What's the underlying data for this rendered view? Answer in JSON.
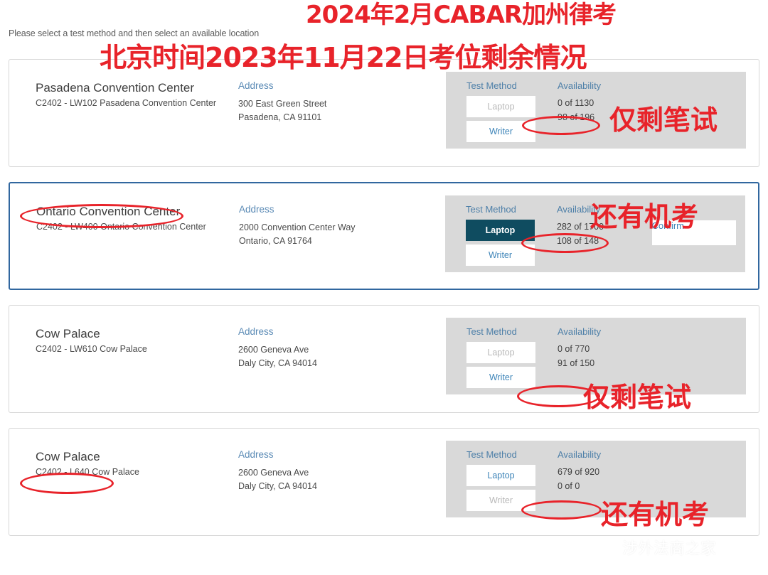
{
  "instruction": "Please select a test method and then select an available location",
  "annotations": {
    "title_line1": "2024年2月CABAR加州律考",
    "title_line2": "北京时间2023年11月22日考位剩余情况",
    "notes": [
      "仅剩笔试",
      "还有机考",
      "仅剩笔试",
      "还有机考"
    ],
    "color": "#e8232a"
  },
  "watermark": {
    "icon": "wechat-icon",
    "text": "涉外法商之家"
  },
  "columns": {
    "test_method": "Test Method",
    "availability": "Availability",
    "address": "Address"
  },
  "buttons": {
    "laptop": "Laptop",
    "writer": "Writer",
    "confirm": "Confirm"
  },
  "cards": [
    {
      "venue": "Pasadena Convention Center",
      "code": "C2402 - LW102 Pasadena Convention Center",
      "address_line1": "300 East Green Street",
      "address_line2": "Pasadena, CA 91101",
      "laptop_state": "disabled",
      "writer_state": "enabled",
      "avail_laptop": "0 of 1130",
      "avail_writer": "98 of 196",
      "confirm_visible": false,
      "selected": false
    },
    {
      "venue": "Ontario Convention Center",
      "code": "C2402 - LW400 Ontario Convention Center",
      "address_line1": "2000 Convention Center Way",
      "address_line2": "Ontario, CA 91764",
      "laptop_state": "active",
      "writer_state": "enabled",
      "avail_laptop": "282 of 1700",
      "avail_writer": "108 of 148",
      "confirm_visible": true,
      "selected": true
    },
    {
      "venue": "Cow Palace",
      "code": "C2402 - LW610 Cow Palace",
      "address_line1": "2600 Geneva Ave",
      "address_line2": "Daly City, CA 94014",
      "laptop_state": "disabled",
      "writer_state": "enabled",
      "avail_laptop": "0 of 770",
      "avail_writer": "91 of 150",
      "confirm_visible": false,
      "selected": false
    },
    {
      "venue": "Cow Palace",
      "code": "C2402 - L640 Cow Palace",
      "address_line1": "2600 Geneva Ave",
      "address_line2": "Daly City, CA 94014",
      "laptop_state": "enabled",
      "writer_state": "disabled",
      "avail_laptop": "679 of 920",
      "avail_writer": "0 of 0",
      "confirm_visible": false,
      "selected": false
    }
  ]
}
